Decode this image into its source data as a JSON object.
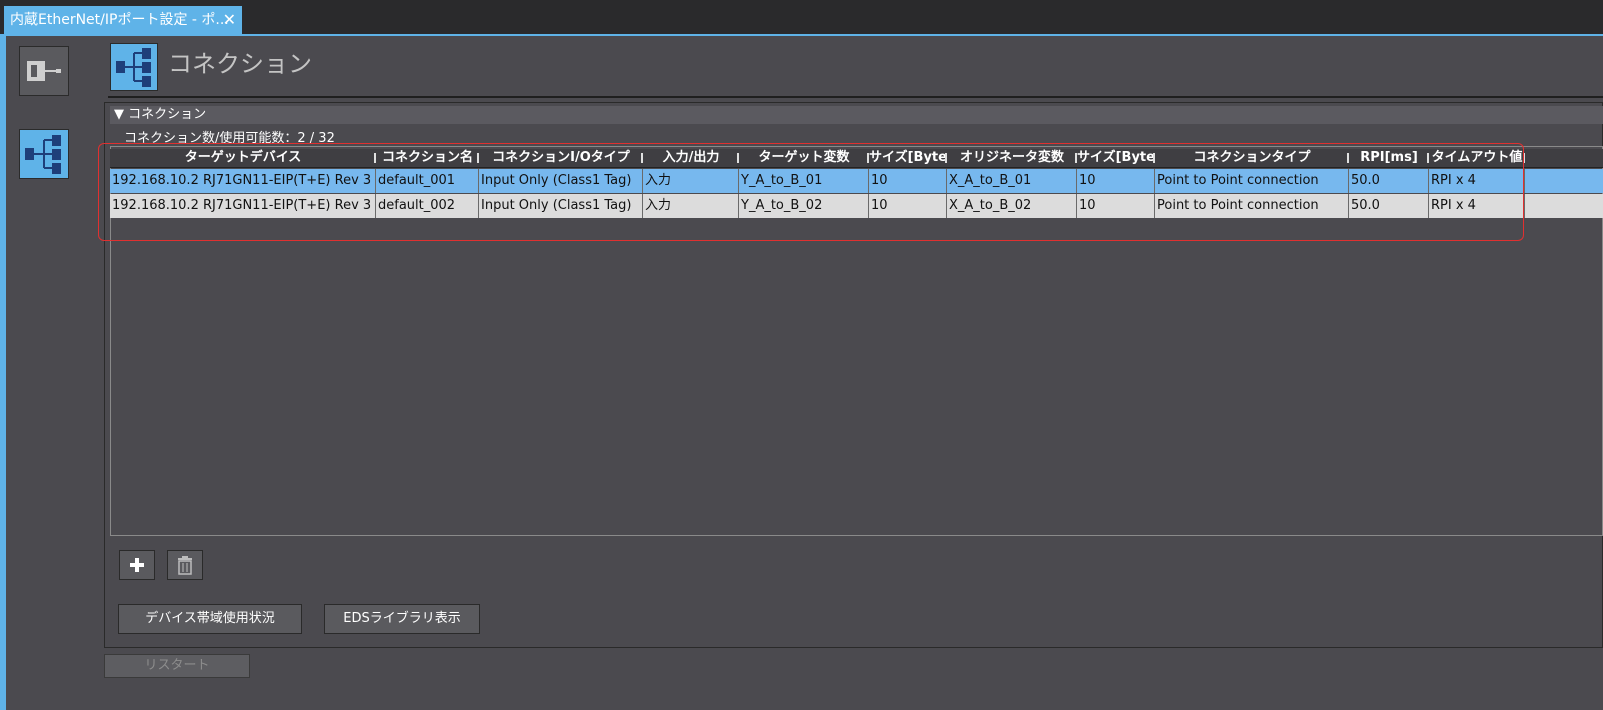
{
  "tab": {
    "title": "内蔵EtherNet/IPポート設定 - ポ...",
    "close": "✕"
  },
  "header": {
    "title": "コネクション"
  },
  "section": {
    "title": "▼ コネクション",
    "count_label": "コネクション数/使用可能数：2 / 32"
  },
  "table": {
    "columns": [
      "ターゲットデバイス",
      "コネクション名",
      "コネクションI/Oタイプ",
      "入力/出力",
      "ターゲット変数",
      "サイズ[Byte]",
      "オリジネータ変数",
      "サイズ[Byte]",
      "コネクションタイプ",
      "RPI[ms]",
      "タイムアウト値"
    ],
    "rows": [
      [
        "192.168.10.2 RJ71GN11-EIP(T+E) Rev 3",
        "default_001",
        "Input Only (Class1 Tag)",
        "入力",
        "Y_A_to_B_01",
        "10",
        "X_A_to_B_01",
        "10",
        "Point to Point connection",
        "50.0",
        "RPI x 4"
      ],
      [
        "192.168.10.2 RJ71GN11-EIP(T+E) Rev 3",
        "default_002",
        "Input Only (Class1 Tag)",
        "入力",
        "Y_A_to_B_02",
        "10",
        "X_A_to_B_02",
        "10",
        "Point to Point connection",
        "50.0",
        "RPI x 4"
      ]
    ]
  },
  "buttons": {
    "add": "+",
    "delete": "trash-icon",
    "bandwidth": "デバイス帯域使用状況",
    "eds": "EDSライブラリ表示",
    "restart": "リスタート"
  },
  "colors": {
    "accent": "#5fb3e8",
    "highlight": "#e03030",
    "selected_row": "#77b8ee"
  }
}
